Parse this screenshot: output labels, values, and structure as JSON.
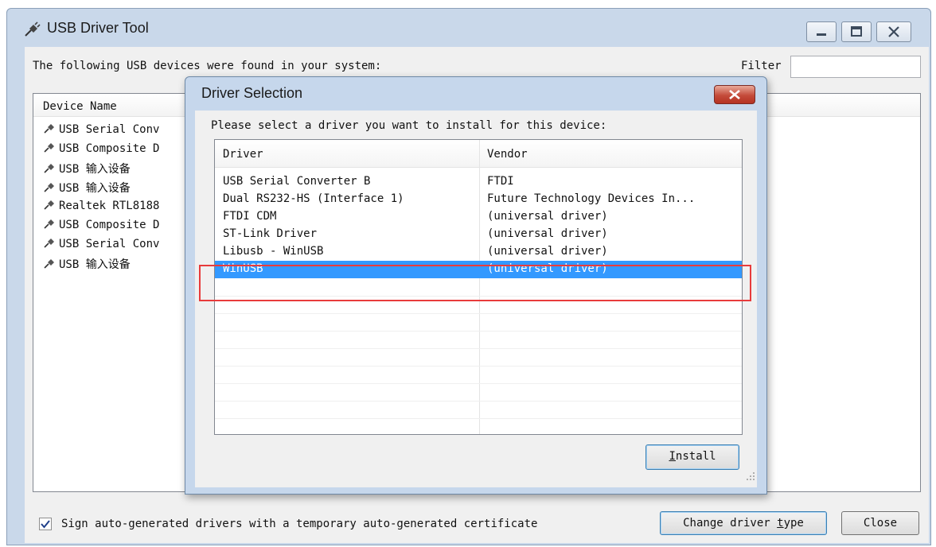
{
  "main_window": {
    "title": "USB Driver Tool",
    "found_label": "The following USB devices were found in your system:",
    "filter_label": "Filter",
    "filter_value": "",
    "device_column": "Device Name",
    "devices": [
      "USB Serial Conv",
      "USB Composite D",
      "USB 输入设备",
      "USB 输入设备",
      "Realtek RTL8188",
      "USB Composite D",
      "USB Serial Conv",
      "USB 输入设备"
    ],
    "sign_checkbox_label": "Sign auto-generated drivers with a temporary auto-generated certificate",
    "sign_checked": true,
    "change_type_button": "Change driver type",
    "change_type_key": "t",
    "close_button": "Close"
  },
  "dialog": {
    "title": "Driver Selection",
    "prompt": "Please select a driver you want to install for this device:",
    "columns": [
      "Driver",
      "Vendor"
    ],
    "rows": [
      {
        "driver": "USB Serial Converter B",
        "vendor": "FTDI"
      },
      {
        "driver": "Dual RS232-HS (Interface 1)",
        "vendor": "Future Technology Devices In..."
      },
      {
        "driver": "FTDI CDM",
        "vendor": "(universal driver)"
      },
      {
        "driver": "ST-Link Driver",
        "vendor": "(universal driver)"
      },
      {
        "driver": "Libusb - WinUSB",
        "vendor": "(universal driver)"
      },
      {
        "driver": "WinUSB",
        "vendor": "(universal driver)"
      }
    ],
    "selected_row": "WinUSB",
    "install_button": "Install",
    "install_key": "I"
  },
  "colors": {
    "selection": "#3399ff",
    "highlight_box": "#e83b3b",
    "frame": "#c9d8ea"
  }
}
